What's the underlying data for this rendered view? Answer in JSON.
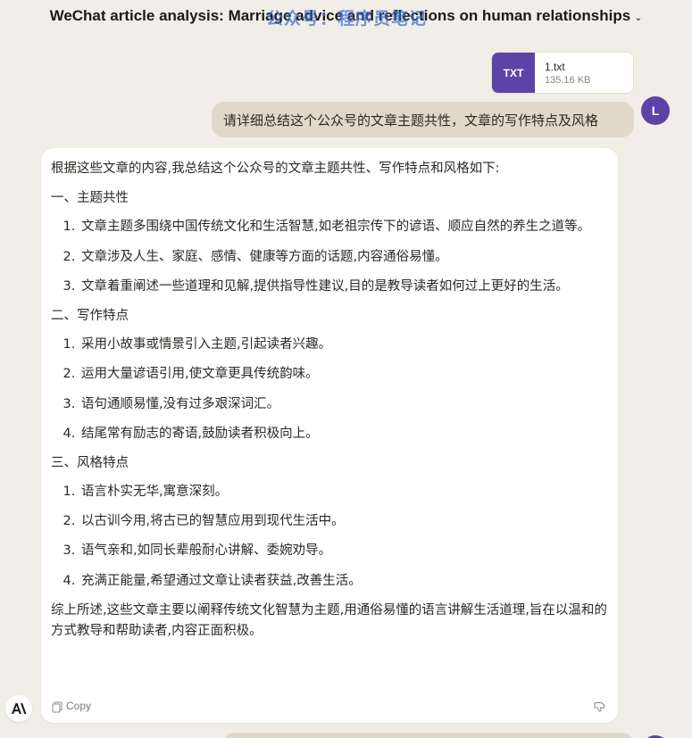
{
  "header": {
    "title": "WeChat article analysis: Marriage advice and reflections on human relationships",
    "watermark": "公众号：程序员笔记"
  },
  "attachment": {
    "type_label": "TXT",
    "file_name": "1.txt",
    "file_size": "135.16 KB"
  },
  "user": {
    "avatar_initial": "L",
    "message": "请详细总结这个公众号的文章主题共性，文章的写作特点及风格"
  },
  "assistant": {
    "intro": "根据这些文章的内容,我总结这个公众号的文章主题共性、写作特点和风格如下:",
    "sections": [
      {
        "heading": "一、主题共性",
        "items": [
          "文章主题多围绕中国传统文化和生活智慧,如老祖宗传下的谚语、顺应自然的养生之道等。",
          "文章涉及人生、家庭、感情、健康等方面的话题,内容通俗易懂。",
          "文章着重阐述一些道理和见解,提供指导性建议,目的是教导读者如何过上更好的生活。"
        ]
      },
      {
        "heading": "二、写作特点",
        "items": [
          "采用小故事或情景引入主题,引起读者兴趣。",
          "运用大量谚语引用,使文章更具传统韵味。",
          "语句通顺易懂,没有过多艰深词汇。",
          "结尾常有励志的寄语,鼓励读者积极向上。"
        ]
      },
      {
        "heading": "三、风格特点",
        "items": [
          "语言朴实无华,寓意深刻。",
          "以古训今用,将古已的智慧应用到现代生活中。",
          "语气亲和,如同长辈般耐心讲解、委婉劝导。",
          "充满正能量,希望通过文章让读者获益,改善生活。"
        ]
      }
    ],
    "summary": "综上所述,这些文章主要以阐释传统文化智慧为主题,用通俗易懂的语言讲解生活道理,旨在以温和的方式教导和帮助读者,内容正面积极。",
    "copy_label": "Copy"
  },
  "colors": {
    "background": "#f0eee6",
    "accent_purple": "#5b43a8",
    "user_bubble": "#e0d9ca",
    "card": "#ffffff"
  },
  "icons": [
    "chevron-down-icon",
    "copy-icon",
    "thumbs-down-icon",
    "anthropic-logo-icon"
  ]
}
